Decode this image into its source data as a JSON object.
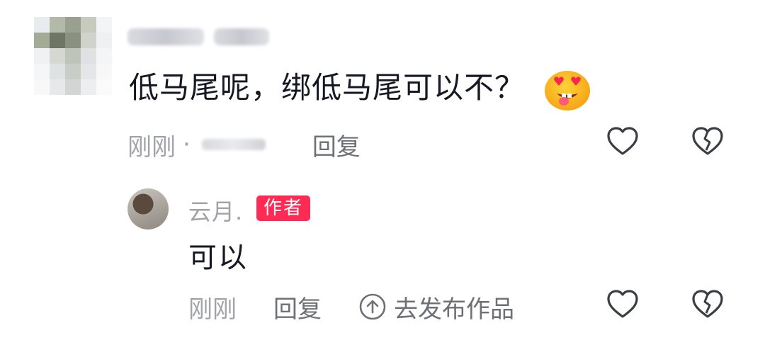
{
  "comment": {
    "text": "低马尾呢，绑低马尾可以不？",
    "time": "刚刚",
    "dot": "·",
    "reply_label": "回复",
    "emoji": "heart-eyes-face-icon"
  },
  "reply": {
    "author_name": "云月.",
    "author_badge": "作者",
    "text": "可以",
    "time": "刚刚",
    "reply_label": "回复",
    "publish_label": "去发布作品"
  },
  "colors": {
    "badge": "#fe2c55",
    "meta_text": "#a1a3a8",
    "main_text": "#161823"
  }
}
